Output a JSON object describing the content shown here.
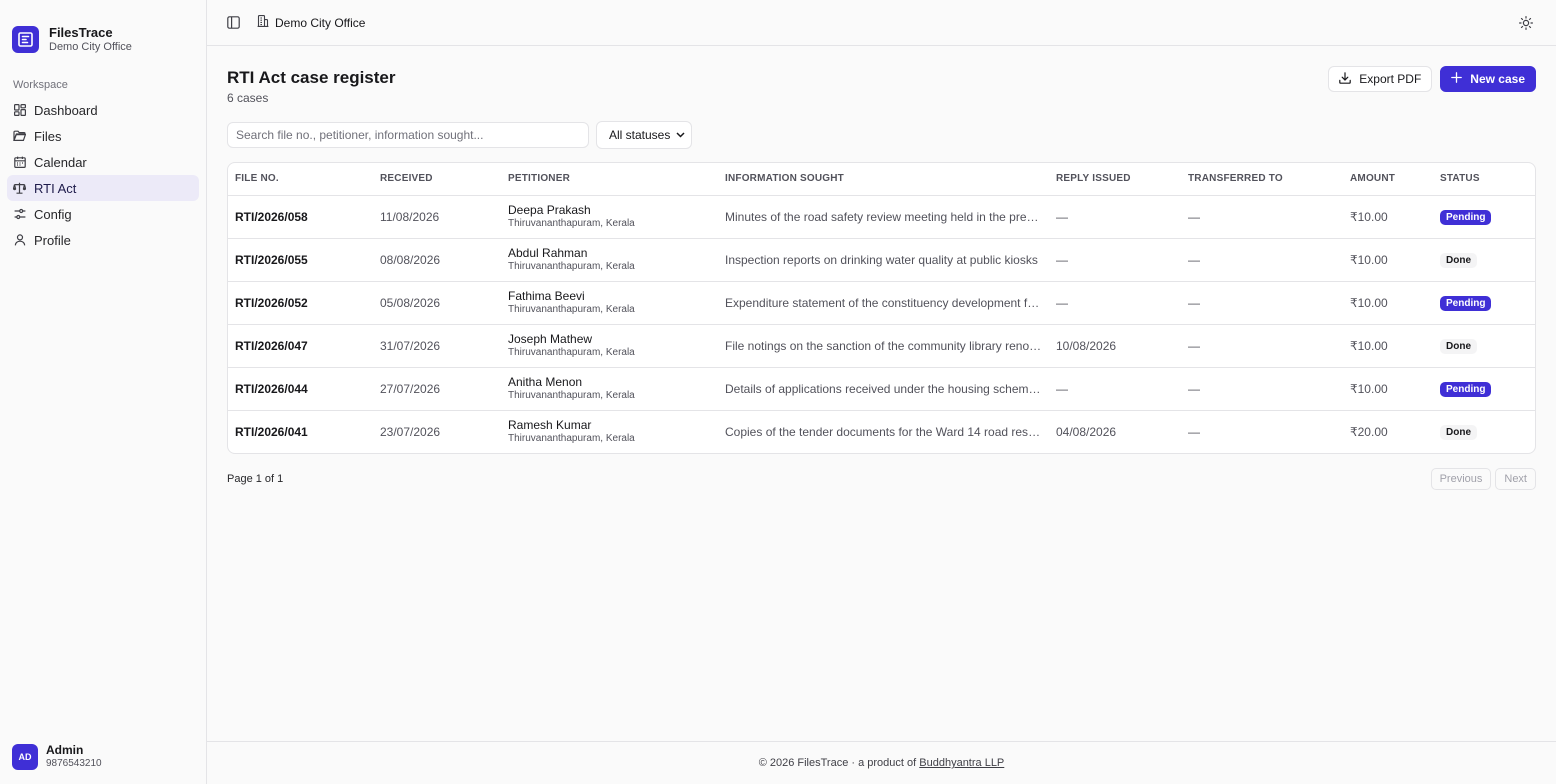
{
  "brand": {
    "name": "FilesTrace",
    "office": "Demo City Office"
  },
  "sidebar": {
    "section_label": "Workspace",
    "items": [
      {
        "label": "Dashboard",
        "icon": "dashboard-icon"
      },
      {
        "label": "Files",
        "icon": "folder-icon"
      },
      {
        "label": "Calendar",
        "icon": "calendar-icon"
      },
      {
        "label": "RTI Act",
        "icon": "scale-icon",
        "active": true
      },
      {
        "label": "Config",
        "icon": "sliders-icon"
      },
      {
        "label": "Profile",
        "icon": "user-icon"
      }
    ],
    "user": {
      "initials": "AD",
      "name": "Admin",
      "phone": "9876543210"
    }
  },
  "topbar": {
    "office": "Demo City Office"
  },
  "page": {
    "title": "RTI Act case register",
    "count": "6 cases",
    "export_label": "Export PDF",
    "new_label": "New case"
  },
  "filters": {
    "search_placeholder": "Search file no., petitioner, information sought...",
    "status_value": "All statuses"
  },
  "table": {
    "headers": [
      "FILE NO.",
      "RECEIVED",
      "PETITIONER",
      "INFORMATION SOUGHT",
      "REPLY ISSUED",
      "TRANSFERRED TO",
      "AMOUNT",
      "STATUS"
    ],
    "rows": [
      {
        "file": "RTI/2026/058",
        "received": "11/08/2026",
        "petitioner": "Deepa Prakash",
        "location": "Thiruvananthapuram, Kerala",
        "info": "Minutes of the road safety review meeting held in the previo...",
        "reply": "—",
        "transferred": "—",
        "amount": "₹10.00",
        "status": "Pending"
      },
      {
        "file": "RTI/2026/055",
        "received": "08/08/2026",
        "petitioner": "Abdul Rahman",
        "location": "Thiruvananthapuram, Kerala",
        "info": "Inspection reports on drinking water quality at public kiosks",
        "reply": "—",
        "transferred": "—",
        "amount": "₹10.00",
        "status": "Done"
      },
      {
        "file": "RTI/2026/052",
        "received": "05/08/2026",
        "petitioner": "Fathima Beevi",
        "location": "Thiruvananthapuram, Kerala",
        "info": "Expenditure statement of the constituency development fun...",
        "reply": "—",
        "transferred": "—",
        "amount": "₹10.00",
        "status": "Pending"
      },
      {
        "file": "RTI/2026/047",
        "received": "31/07/2026",
        "petitioner": "Joseph Mathew",
        "location": "Thiruvananthapuram, Kerala",
        "info": "File notings on the sanction of the community library renova...",
        "reply": "10/08/2026",
        "transferred": "—",
        "amount": "₹10.00",
        "status": "Done"
      },
      {
        "file": "RTI/2026/044",
        "received": "27/07/2026",
        "petitioner": "Anitha Menon",
        "location": "Thiruvananthapuram, Kerala",
        "info": "Details of applications received under the housing scheme i...",
        "reply": "—",
        "transferred": "—",
        "amount": "₹10.00",
        "status": "Pending"
      },
      {
        "file": "RTI/2026/041",
        "received": "23/07/2026",
        "petitioner": "Ramesh Kumar",
        "location": "Thiruvananthapuram, Kerala",
        "info": "Copies of the tender documents for the Ward 14 road resurf...",
        "reply": "04/08/2026",
        "transferred": "—",
        "amount": "₹20.00",
        "status": "Done"
      }
    ]
  },
  "pager": {
    "info": "Page 1 of 1",
    "previous": "Previous",
    "next": "Next"
  },
  "footer": {
    "text": "© 2026 FilesTrace · a product of",
    "link": "Buddhyantra LLP"
  },
  "colors": {
    "accent": "#3f2fd6",
    "border": "#e4e4e7",
    "background": "#fafafa"
  }
}
